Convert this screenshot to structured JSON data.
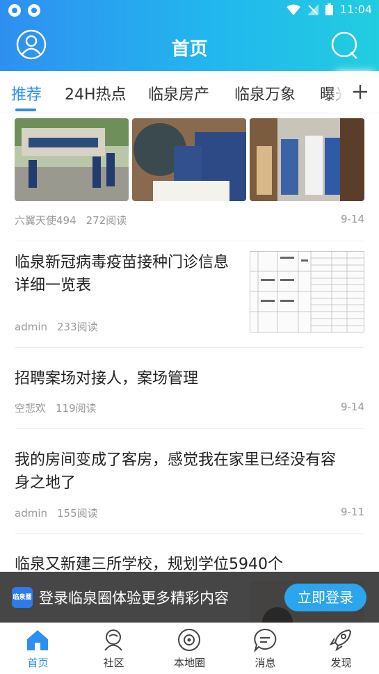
{
  "status_bar": {
    "time": "11:04"
  },
  "header": {
    "title": "首页"
  },
  "tabs": [
    {
      "label": "推荐",
      "active": true
    },
    {
      "label": "24H热点"
    },
    {
      "label": "临泉房产"
    },
    {
      "label": "临泉万象"
    },
    {
      "label": "曝光"
    }
  ],
  "feed": {
    "item1": {
      "author": "六翼天使494",
      "reads": "272阅读",
      "date": "9-14"
    },
    "item2": {
      "title_line1": "临泉新冠病毒疫苗接种门诊信息",
      "title_line2": "详细一览表",
      "author": "admin",
      "reads": "233阅读"
    },
    "item3": {
      "title": "招聘案场对接人，案场管理",
      "author": "空悲欢",
      "reads": "119阅读",
      "date": "9-14"
    },
    "item4": {
      "title_line1": "我的房间变成了客房，感觉我在家里已经没有容",
      "title_line2": "身之地了",
      "author": "admin",
      "reads": "155阅读",
      "date": "9-11"
    },
    "item5": {
      "title": "临泉又新建三所学校，规划学位5940个"
    }
  },
  "banner": {
    "logo_text": "临泉圈",
    "text": "登录临泉圈体验更多精彩内容",
    "button": "立即登录"
  },
  "bottom_nav": [
    {
      "label": "首页",
      "active": true,
      "icon": "home-icon"
    },
    {
      "label": "社区",
      "icon": "community-icon"
    },
    {
      "label": "本地圈",
      "icon": "local-circle-icon"
    },
    {
      "label": "消息",
      "icon": "message-icon"
    },
    {
      "label": "发现",
      "icon": "rocket-icon"
    }
  ],
  "colors": {
    "accent": "#2d8ff0",
    "header_start": "#2f8ff0",
    "header_end": "#22cde0"
  }
}
